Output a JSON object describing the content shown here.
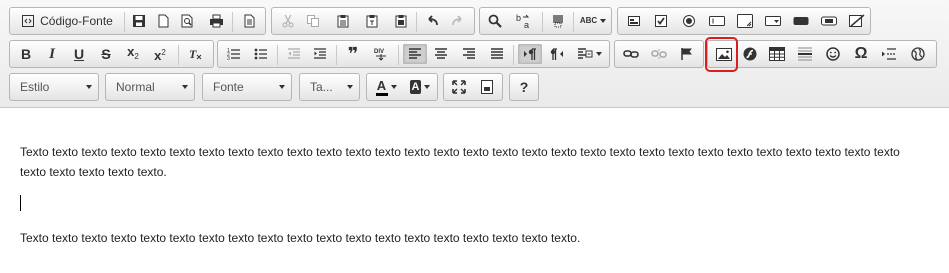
{
  "toolbar": {
    "source_label": "Código-Fonte",
    "styles_combo": {
      "label": "Estilo"
    },
    "format_combo": {
      "label": "Normal"
    },
    "font_combo": {
      "label": "Fonte"
    },
    "size_combo": {
      "label": "Ta..."
    },
    "help_label": "?",
    "subscript_label": "x",
    "superscript_label": "x",
    "quote_label": "❞",
    "div_label": "DIV",
    "spell_label": "ABC",
    "special_char_label": "Ω",
    "text_color_label": "A",
    "bg_color_label": "A"
  },
  "editor": {
    "paragraphs": [
      "Texto texto texto texto texto texto texto texto texto texto texto texto texto texto texto texto texto texto texto texto texto texto texto texto texto texto texto texto texto texto texto texto texto texto texto.",
      "Texto texto texto texto texto texto texto texto texto texto texto texto texto texto texto texto texto texto texto."
    ]
  },
  "highlight_color": "#d62020"
}
